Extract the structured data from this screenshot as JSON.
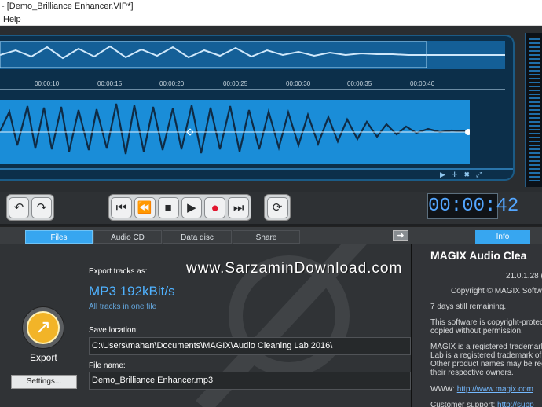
{
  "window": {
    "title": "[Demo_Brilliance Enhancer.VIP*]",
    "title_prefix": "-"
  },
  "menu": {
    "help": "Help"
  },
  "ruler": {
    "ticks": [
      "00:00:10",
      "00:00:15",
      "00:00:20",
      "00:00:25",
      "00:00:30",
      "00:00:35",
      "00:00:40"
    ]
  },
  "transport": {
    "time": "00:00:42"
  },
  "tabs": [
    "Files",
    "Audio CD",
    "Data disc",
    "Share"
  ],
  "active_tab": "Files",
  "info_tab": "Info",
  "export": {
    "export_tracks_label": "Export tracks as:",
    "format": "MP3  192kBit/s",
    "tracks_mode": "All tracks in one file",
    "save_location_label": "Save location:",
    "save_location": "C:\\Users\\mahan\\Documents\\MAGIX\\Audio Cleaning Lab 2016\\",
    "file_name_label": "File name:",
    "file_name": "Demo_Brilliance Enhancer.mp3",
    "export_button": "Export",
    "settings_button": "Settings..."
  },
  "info": {
    "product": "MAGIX Audio Clea",
    "version": "21.0.1.28 (",
    "copyright": "Copyright © MAGIX Softwa",
    "remaining": "7 days still remaining.",
    "copyright_text_1": "This software is copyright-protec",
    "copyright_text_2": "copied without permission.",
    "trademark_1": "MAGIX is a registered trademark",
    "trademark_2": "Lab is a registered trademark of",
    "trademark_3": "Other product names may be reg",
    "trademark_4": "their respective owners.",
    "www_label": "WWW:",
    "www_link": "http://www.magix.com",
    "support_label": "Customer support:",
    "support_link": "http://supp"
  },
  "watermark": "www.SarzaminDownload.com",
  "colors": {
    "accent": "#37a6f0",
    "timecode": "#53a6ff",
    "record": "#e2162f",
    "waveform": "#1a8dd8"
  }
}
